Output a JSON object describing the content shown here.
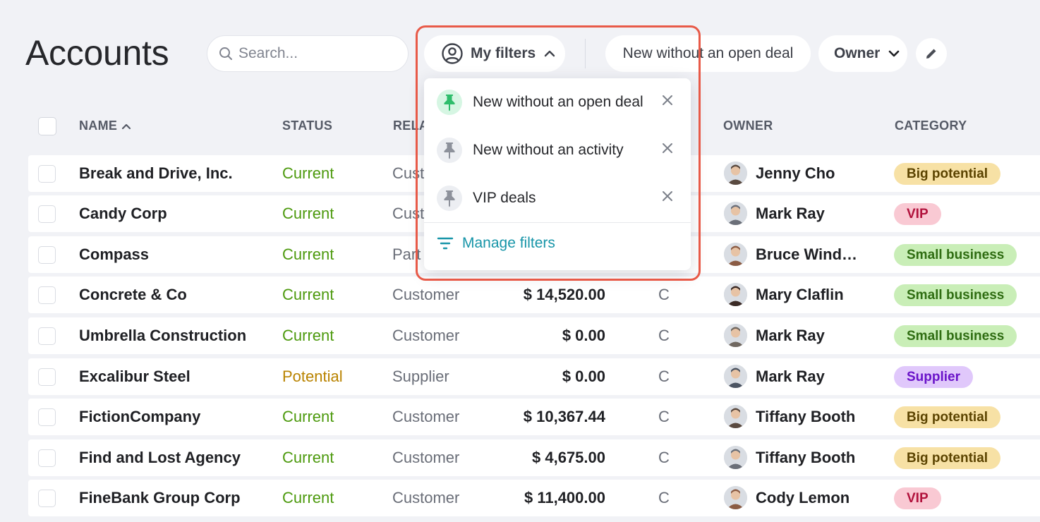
{
  "header": {
    "title": "Accounts",
    "search_placeholder": "Search...",
    "my_filters_label": "My filters",
    "saved_filter_label": "New without an open deal",
    "owner_label": "Owner"
  },
  "table": {
    "columns": [
      "NAME",
      "STATUS",
      "RELA",
      "OWNER",
      "CATEGORY"
    ],
    "rows": [
      {
        "name": "Break and Drive, Inc.",
        "status": "Current",
        "relation": "Cust",
        "amount": "",
        "extra": "",
        "owner": "Jenny Cho",
        "category": "Big potential"
      },
      {
        "name": "Candy Corp",
        "status": "Current",
        "relation": "Cust",
        "amount": "",
        "extra": "",
        "owner": "Mark Ray",
        "category": "VIP"
      },
      {
        "name": "Compass",
        "status": "Current",
        "relation": "Part",
        "amount": "",
        "extra": "",
        "owner": "Bruce Windh…",
        "category": "Small business"
      },
      {
        "name": "Concrete & Co",
        "status": "Current",
        "relation": "Customer",
        "amount": "$ 14,520.00",
        "extra": "C",
        "owner": "Mary Claflin",
        "category": "Small business"
      },
      {
        "name": "Umbrella Construction",
        "status": "Current",
        "relation": "Customer",
        "amount": "$ 0.00",
        "extra": "C",
        "owner": "Mark Ray",
        "category": "Small business"
      },
      {
        "name": "Excalibur Steel",
        "status": "Potential",
        "relation": "Supplier",
        "amount": "$ 0.00",
        "extra": "C",
        "owner": "Mark Ray",
        "category": "Supplier"
      },
      {
        "name": "FictionCompany",
        "status": "Current",
        "relation": "Customer",
        "amount": "$ 10,367.44",
        "extra": "C",
        "owner": "Tiffany Booth",
        "category": "Big potential"
      },
      {
        "name": "Find and Lost Agency",
        "status": "Current",
        "relation": "Customer",
        "amount": "$ 4,675.00",
        "extra": "C",
        "owner": "Tiffany Booth",
        "category": "Big potential"
      },
      {
        "name": "FineBank Group Corp",
        "status": "Current",
        "relation": "Customer",
        "amount": "$ 11,400.00",
        "extra": "C",
        "owner": "Cody Lemon",
        "category": "VIP"
      }
    ]
  },
  "dropdown": {
    "items": [
      {
        "label": "New without an open deal",
        "pinned": true
      },
      {
        "label": "New without an activity",
        "pinned": false
      },
      {
        "label": "VIP deals",
        "pinned": false
      }
    ],
    "manage_label": "Manage filters"
  },
  "colors": {
    "status_current": "#4d9a0e",
    "status_potential": "#b98300",
    "badge_big_potential": "#f7e1a5",
    "badge_vip": "#f9c9d3",
    "badge_small_business": "#c9eeb7",
    "badge_supplier": "#e0c8fb",
    "link_teal": "#1795a8",
    "pin_active_bg": "#d6f6e3",
    "pin_active": "#2ebd6b",
    "highlight": "#e85a48"
  },
  "icons": {
    "search": "search-icon",
    "user_circle": "user-circle-icon",
    "chevron_up": "chevron-up-icon",
    "chevron_down": "chevron-down-icon",
    "pencil": "pencil-icon",
    "pin": "pin-icon",
    "close": "close-icon",
    "filter_lines": "filter-lines-icon",
    "sort_asc": "sort-asc-icon"
  }
}
